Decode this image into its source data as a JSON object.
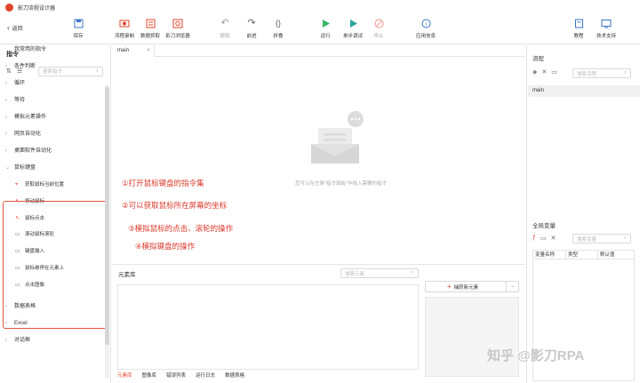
{
  "window": {
    "title": "影刀流程设计器"
  },
  "toolbar": {
    "back_label": "返回",
    "items": [
      {
        "id": "save",
        "label": "保存",
        "icon": "save-icon"
      },
      {
        "id": "record",
        "label": "流程录制",
        "icon": "record-icon"
      },
      {
        "id": "grab",
        "label": "数据抓取",
        "icon": "grab-icon"
      },
      {
        "id": "browser",
        "label": "影刀浏览器",
        "icon": "browser-icon"
      },
      {
        "id": "undo",
        "label": "撤销",
        "icon": "undo-icon"
      },
      {
        "id": "redo",
        "label": "前进",
        "icon": "redo-icon"
      },
      {
        "id": "fold",
        "label": "折叠",
        "icon": "fold-icon"
      },
      {
        "id": "run",
        "label": "运行",
        "icon": "play-icon"
      },
      {
        "id": "debug",
        "label": "单步调试",
        "icon": "step-debug-icon"
      },
      {
        "id": "stop",
        "label": "停止",
        "icon": "stop-icon"
      },
      {
        "id": "info",
        "label": "应用信息",
        "icon": "info-icon"
      },
      {
        "id": "tutorial",
        "label": "教程",
        "icon": "tutorial-icon"
      },
      {
        "id": "support",
        "label": "技术支持",
        "icon": "support-icon"
      }
    ]
  },
  "left": {
    "title": "指令",
    "search_placeholder": "搜索指令",
    "tree": [
      {
        "label": "我常用的指令"
      },
      {
        "label": "条件判断"
      },
      {
        "label": "循环"
      },
      {
        "label": "等待"
      },
      {
        "label": "模拟元素操作"
      },
      {
        "label": "网页自动化"
      },
      {
        "label": "桌面软件自动化"
      },
      {
        "label": "鼠标键盘"
      }
    ],
    "sub_items": [
      {
        "label": "获取鼠标当前位置"
      },
      {
        "label": "移动鼠标"
      },
      {
        "label": "鼠标点击"
      },
      {
        "label": "滚动鼠标滚轮"
      },
      {
        "label": "键盘输入"
      },
      {
        "label": "鼠标悬停在元素上"
      },
      {
        "label": "点击图像"
      }
    ],
    "tree_after": [
      {
        "label": "数据表格"
      },
      {
        "label": "Excel"
      },
      {
        "label": "对话框"
      }
    ]
  },
  "center": {
    "tab_label": "main",
    "empty_text": "您可以在左侧\"指令面板\"中拖入需要的指令"
  },
  "annotations": [
    "①打开鼠标键盘的指令集",
    "②可以获取鼠标所在屏幕的坐标",
    "③模拟鼠标的点击、滚轮的操作",
    "④模拟键盘的操作"
  ],
  "element_lib": {
    "title": "元素库",
    "search_placeholder": "搜索元素",
    "capture_label": "捕获新元素",
    "tabs": [
      "元素库",
      "图像库",
      "错误列表",
      "运行日志",
      "数据表格"
    ]
  },
  "right": {
    "flow_title": "流程",
    "flow_search_placeholder": "搜索流程",
    "flow_item": "main",
    "vars_title": "全局变量",
    "vars_search_placeholder": "搜索变量",
    "columns": [
      "变量名称",
      "类型",
      "默认值"
    ]
  },
  "watermark": "知乎 @影刀RPA",
  "colors": {
    "accent": "#e0452b",
    "run_green": "#3bb36a"
  }
}
